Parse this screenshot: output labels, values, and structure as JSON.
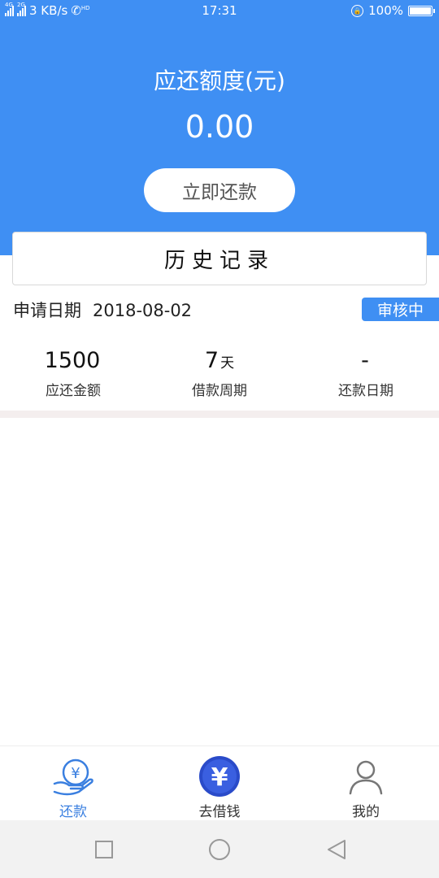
{
  "status_bar": {
    "net_tag_1": "4G",
    "net_tag_2": "2G",
    "speed": "3 KB/s",
    "hd": "HD",
    "time": "17:31",
    "battery": "100%"
  },
  "header": {
    "title": "应还额度(元)",
    "amount": "0.00",
    "repay_button": "立即还款"
  },
  "history": {
    "label": "历史记录"
  },
  "record": {
    "apply_label": "申请日期",
    "apply_date": "2018-08-02",
    "status": "审核中",
    "stats": [
      {
        "value": "1500",
        "unit": "",
        "label": "应还金额"
      },
      {
        "value": "7",
        "unit": "天",
        "label": "借款周期"
      },
      {
        "value": "-",
        "unit": "",
        "label": "还款日期"
      }
    ]
  },
  "tabbar": {
    "items": [
      {
        "label": "还款",
        "icon": "repay-hand-icon",
        "active": true
      },
      {
        "label": "去借钱",
        "icon": "yen-coin-icon",
        "active": false
      },
      {
        "label": "我的",
        "icon": "user-icon",
        "active": false
      }
    ]
  },
  "colors": {
    "primary": "#3f8ff3",
    "tab_active": "#3a7fe0",
    "tab_inactive": "#333333"
  }
}
